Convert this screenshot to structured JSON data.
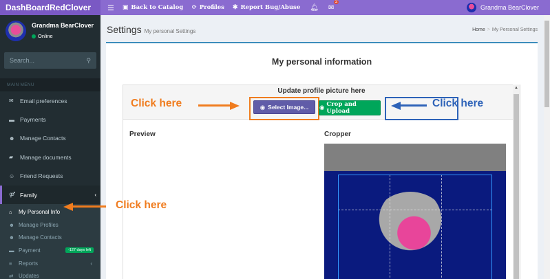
{
  "brand": "DashBoardRedClover",
  "topnav": {
    "back_label": "Back to Catalog",
    "profiles_label": "Profiles",
    "report_label": "Report Bug/Abuse",
    "notif_count": "2",
    "user_name": "Grandma BearClover"
  },
  "sidebar": {
    "user_name": "Grandma BearClover",
    "user_status": "Online",
    "search_placeholder": "Search...",
    "section_label": "MAIN MENU",
    "items": [
      {
        "label": "Email preferences",
        "icon": "envelope-icon"
      },
      {
        "label": "Payments",
        "icon": "credit-card-icon"
      },
      {
        "label": "Manage Contacts",
        "icon": "users-icon"
      },
      {
        "label": "Manage documents",
        "icon": "folder-icon"
      },
      {
        "label": "Friend Requests",
        "icon": "user-plus-icon"
      },
      {
        "label": "Family",
        "icon": "family-icon"
      }
    ],
    "subitems": [
      {
        "label": "My Personal Info",
        "icon": "home-icon"
      },
      {
        "label": "Manage Profiles",
        "icon": "users-icon"
      },
      {
        "label": "Manage Contacts",
        "icon": "users-icon"
      },
      {
        "label": "Payment",
        "icon": "credit-card-icon",
        "badge": "-127 days left"
      },
      {
        "label": "Reports",
        "icon": "list-icon"
      },
      {
        "label": "Updates",
        "icon": "retweet-icon"
      }
    ]
  },
  "header": {
    "title": "Settings",
    "subtitle": "My personal Settings",
    "breadcrumb": [
      "Home",
      "My Personal Settings"
    ]
  },
  "box": {
    "title": "My personal information",
    "upload_title": "Update profile picture here",
    "select_label": "Select Image...",
    "crop_label": "Crop and Upload",
    "preview_label": "Preview",
    "cropper_label": "Cropper"
  },
  "annotations": {
    "left_click": "Click here",
    "right_click": "Click here",
    "sidebar_click": "Click here"
  },
  "colors": {
    "accent": "#8a6bd0",
    "orange": "#f07c1e",
    "blue": "#2d62b8",
    "select_btn": "#605ca8",
    "crop_btn": "#00a65a"
  }
}
